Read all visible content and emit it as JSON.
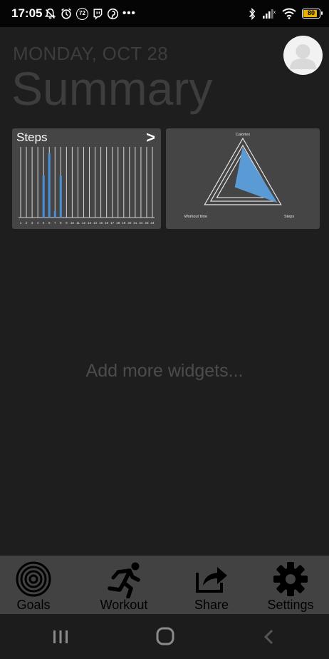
{
  "status_bar": {
    "time": "17:05",
    "notification_badge": "72",
    "overflow": "•••",
    "battery_level": "80",
    "icons": [
      "bell-off-icon",
      "alarm-icon",
      "badge-icon",
      "twitch-icon",
      "pinterest-icon",
      "bluetooth-icon",
      "signal-icon",
      "wifi-icon",
      "battery-icon"
    ]
  },
  "header": {
    "date": "MONDAY, OCT 28",
    "title": "Summary"
  },
  "widgets": {
    "steps": {
      "title": "Steps",
      "open_label": ">",
      "chart_data": {
        "type": "bar",
        "categories": [
          "1",
          "2",
          "3",
          "4",
          "5",
          "6",
          "7",
          "8",
          "9",
          "10",
          "11",
          "12",
          "13",
          "14",
          "15",
          "16",
          "17",
          "18",
          "19",
          "20",
          "21",
          "22",
          "23",
          "24"
        ],
        "values": [
          0,
          0,
          0,
          0,
          0.65,
          1.0,
          0.1,
          0.65,
          0,
          0,
          0,
          0,
          0,
          0,
          0,
          0,
          0,
          0,
          0,
          0,
          0,
          0,
          0,
          0
        ],
        "ylim": [
          0,
          1.1
        ],
        "color": "#4a90d9"
      }
    },
    "radar": {
      "chart_data": {
        "type": "radar",
        "axes": [
          "Calories",
          "Steps",
          "Workout time"
        ],
        "values": [
          0.78,
          0.88,
          0.2
        ],
        "color": "#5b9bd5"
      }
    }
  },
  "placeholder": "Add more widgets...",
  "bottom_nav": [
    {
      "label": "Goals",
      "icon": "target-icon"
    },
    {
      "label": "Workout",
      "icon": "running-icon"
    },
    {
      "label": "Share",
      "icon": "share-icon"
    },
    {
      "label": "Settings",
      "icon": "gear-icon"
    }
  ],
  "system_nav": [
    "recents-icon",
    "home-icon",
    "back-icon"
  ]
}
